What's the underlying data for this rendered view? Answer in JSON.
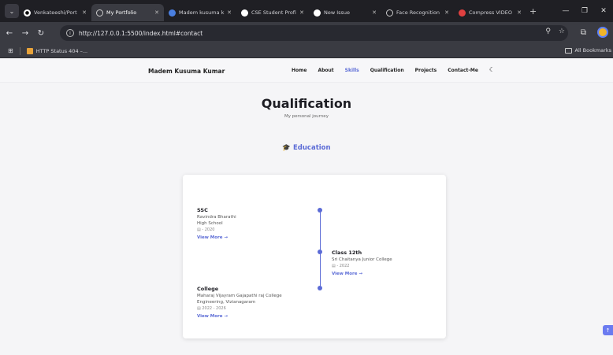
{
  "browser": {
    "tabs": [
      {
        "title": "Venkateeshi/Port"
      },
      {
        "title": "My Portfolio"
      },
      {
        "title": "Madem kusuma k"
      },
      {
        "title": "CSE Student Profi"
      },
      {
        "title": "New Issue"
      },
      {
        "title": "Face Recognition"
      },
      {
        "title": "Compress VIDEO"
      }
    ],
    "url": "http://127.0.0.1:5500/index.html#contact",
    "bookmarks": {
      "item": "HTTP Status 404 –...",
      "all": "All Bookmarks"
    }
  },
  "site": {
    "brand": "Madem Kusuma Kumar",
    "menu": {
      "home": "Home",
      "about": "About",
      "skills": "Skills",
      "qualification": "Qualification",
      "projects": "Projects",
      "contact": "Contact-Me"
    }
  },
  "qualification": {
    "title": "Qualification",
    "subtitle": "My personal journey",
    "tab": "Education",
    "entries": [
      {
        "title": "SSC",
        "line1": "Ravindra Bharathi",
        "line2": "High School",
        "date": "2020",
        "more": "View More →"
      },
      {
        "title": "Class 12th",
        "line1": "Sri Chaitanya Junior College",
        "date": "2022",
        "more": "View More →"
      },
      {
        "title": "College",
        "line1": "Maharaj Vijayram Gajapathi raj College",
        "line2": "Engineering, Vizianagaram",
        "date": "2022 - 2026",
        "more": "View More →"
      }
    ]
  },
  "colors": {
    "accent": "#5b6bd6",
    "chrome": "#1f1f24"
  }
}
